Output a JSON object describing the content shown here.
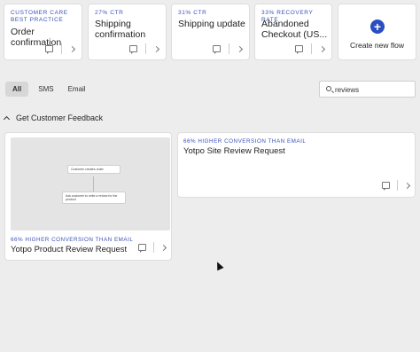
{
  "top_flows": [
    {
      "tag_line1": "CUSTOMER CARE",
      "tag_line2": "BEST PRACTICE",
      "name_line1": "Order",
      "name_line2": "confirmation"
    },
    {
      "tag_line1": "27% CTR",
      "tag_line2": "",
      "name_line1": "Shipping",
      "name_line2": "confirmation"
    },
    {
      "tag_line1": "31% CTR",
      "tag_line2": "",
      "name_line1": "Shipping update",
      "name_line2": ""
    },
    {
      "tag_line1": "33% RECOVERY RATE",
      "tag_line2": "",
      "name_line1": "Abandoned",
      "name_line2": "Checkout (US..."
    }
  ],
  "create_flow": {
    "icon": "plus",
    "label": "Create new flow"
  },
  "filters": {
    "tabs": [
      "All",
      "SMS",
      "Email"
    ],
    "active": "All"
  },
  "search": {
    "value": "reviews",
    "icon": "search-icon"
  },
  "section": {
    "title": "Get Customer Feedback",
    "icon": "chevron-up-icon"
  },
  "flow_cards": [
    {
      "tag": "66% HIGHER CONVERSION THAN EMAIL",
      "name": "Yotpo Product Review Request",
      "preview": {
        "node1": "Customer creates order",
        "node2": "Ask customer to write a review for the product"
      }
    },
    {
      "tag": "66% HIGHER CONVERSION THAN EMAIL",
      "name": "Yotpo Site Review Request"
    }
  ],
  "colors": {
    "accent": "#2a4ec2",
    "tag_blue": "#3b51b8",
    "background": "#ededed"
  }
}
